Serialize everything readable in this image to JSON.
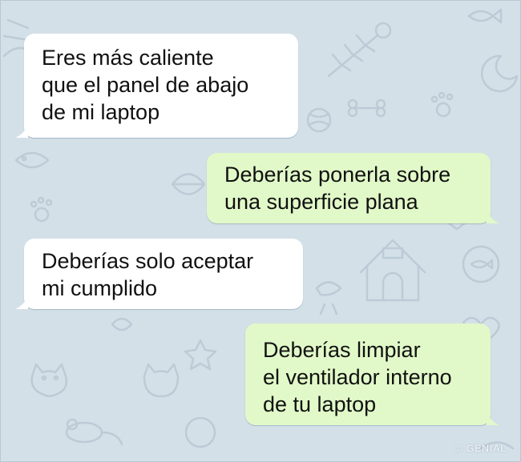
{
  "chat": {
    "background_color": "#d3e0e8",
    "incoming_bubble_color": "#ffffff",
    "outgoing_bubble_color": "#e1f9c8",
    "messages": [
      {
        "direction": "incoming",
        "lines": [
          "Eres más caliente",
          "que el panel de abajo",
          "de mi laptop"
        ]
      },
      {
        "direction": "outgoing",
        "lines": [
          "Deberías ponerla sobre",
          "una superficie plana"
        ]
      },
      {
        "direction": "incoming",
        "lines": [
          "Deberías solo aceptar",
          "mi cumplido"
        ]
      },
      {
        "direction": "outgoing",
        "lines": [
          "Deberías limpiar",
          "el ventilador interno",
          "de tu laptop"
        ]
      }
    ]
  },
  "watermark": {
    "text": "© GENIAL"
  }
}
